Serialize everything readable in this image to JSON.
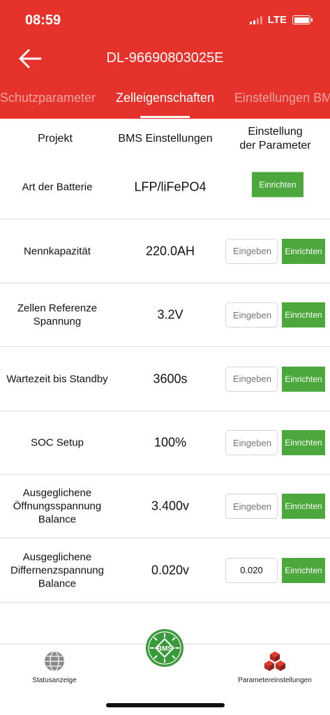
{
  "status_bar": {
    "time": "08:59",
    "network": "LTE"
  },
  "header": {
    "title": "DL-96690803025E"
  },
  "tabs": [
    {
      "label": "Schutzparameter"
    },
    {
      "label": "Zelleigenschaften"
    },
    {
      "label": "Einstellungen BMS"
    }
  ],
  "columns": {
    "project": "Projekt",
    "bms_settings": "BMS Einstellungen",
    "param_line1": "Einstellung",
    "param_line2": "der Parameter"
  },
  "rows": [
    {
      "label_lines": [
        "Art der Batterie"
      ],
      "value": "LFP/liFePO4",
      "button": "Einrichten"
    },
    {
      "label_lines": [
        "Nennkapazität"
      ],
      "value": "220.0AH",
      "placeholder": "Eingeben",
      "button": "Einrichten"
    },
    {
      "label_lines": [
        "Zellen Referenze",
        "Spannung"
      ],
      "value": "3.2V",
      "placeholder": "Eingeben",
      "button": "Einrichten"
    },
    {
      "label_lines": [
        "Wartezeit bis Standby"
      ],
      "value": "3600s",
      "placeholder": "Eingeben",
      "button": "Einrichten"
    },
    {
      "label_lines": [
        "SOC Setup"
      ],
      "value": "100%",
      "placeholder": "Eingeben",
      "button": "Einrichten"
    },
    {
      "label_lines": [
        "Ausgeglichene",
        "Öffnungsspannung",
        "Balance"
      ],
      "value": "3.400v",
      "placeholder": "Eingeben",
      "button": "Einrichten"
    },
    {
      "label_lines": [
        "Ausgeglichene",
        "Differnenzspannung",
        "Balance"
      ],
      "value": "0.020v",
      "input_value": "0.020",
      "button": "Einrichten"
    }
  ],
  "bottom_nav": {
    "left_label": "Statusanzeige",
    "center_label": "BMS",
    "right_label": "Parametereinstellungen"
  },
  "colors": {
    "brand_red": "#e5322b",
    "button_green": "#4ca83d",
    "divider": "#dcdcdc"
  }
}
